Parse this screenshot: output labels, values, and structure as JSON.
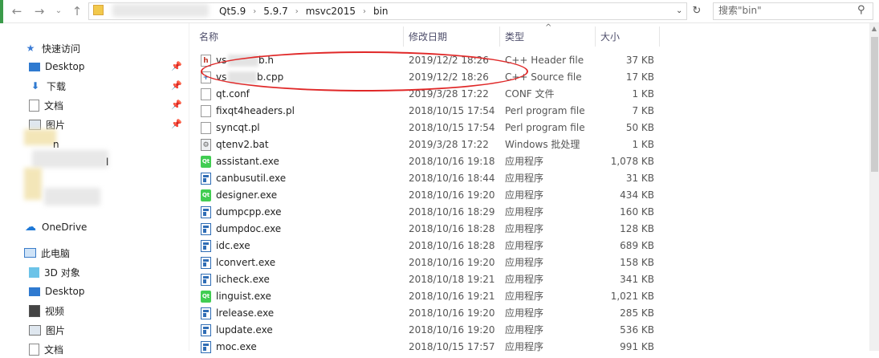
{
  "address": {
    "crumbs": [
      "Qt5.9",
      "5.9.7",
      "msvc2015",
      "bin"
    ],
    "search_placeholder": "搜索\"bin\""
  },
  "sidebar": {
    "items": [
      {
        "label": "快速访问",
        "icon": "star-icon"
      },
      {
        "label": "Desktop",
        "icon": "desktop-icon",
        "pinned": true
      },
      {
        "label": "下载",
        "icon": "download-icon",
        "pinned": true
      },
      {
        "label": "文档",
        "icon": "documents-icon",
        "pinned": true
      },
      {
        "label": "图片",
        "icon": "pictures-icon",
        "pinned": true
      },
      {
        "label": "n",
        "icon": "folder-icon"
      },
      {
        "label": "l",
        "icon": "folder-icon"
      },
      {
        "label": "OneDrive",
        "icon": "onedrive-icon"
      },
      {
        "label": "此电脑",
        "icon": "this-pc-icon"
      },
      {
        "label": "3D 对象",
        "icon": "3d-objects-icon"
      },
      {
        "label": "Desktop",
        "icon": "desktop-icon"
      },
      {
        "label": "视频",
        "icon": "videos-icon"
      },
      {
        "label": "图片",
        "icon": "pictures-icon"
      },
      {
        "label": "文档",
        "icon": "documents-icon"
      }
    ]
  },
  "columns": {
    "name": "名称",
    "date": "修改日期",
    "type": "类型",
    "size": "大小"
  },
  "files": [
    {
      "name_start": "vs",
      "name_end": "b.h",
      "date": "2019/12/2 18:26",
      "type": "C++ Header file",
      "size": "37 KB",
      "icon": "header-file-icon"
    },
    {
      "name_start": "vs",
      "name_end": "b.cpp",
      "date": "2019/12/2 18:26",
      "type": "C++ Source file",
      "size": "17 KB",
      "icon": "cpp-file-icon"
    },
    {
      "name": "qt.conf",
      "date": "2019/3/28 17:22",
      "type": "CONF 文件",
      "size": "1 KB",
      "icon": "file-icon"
    },
    {
      "name": "fixqt4headers.pl",
      "date": "2018/10/15 17:54",
      "type": "Perl program file",
      "size": "7 KB",
      "icon": "file-icon"
    },
    {
      "name": "syncqt.pl",
      "date": "2018/10/15 17:54",
      "type": "Perl program file",
      "size": "50 KB",
      "icon": "file-icon"
    },
    {
      "name": "qtenv2.bat",
      "date": "2019/3/28 17:22",
      "type": "Windows 批处理",
      "size": "1 KB",
      "icon": "batch-file-icon"
    },
    {
      "name": "assistant.exe",
      "date": "2018/10/16 19:18",
      "type": "应用程序",
      "size": "1,078 KB",
      "icon": "qt-app-icon"
    },
    {
      "name": "canbusutil.exe",
      "date": "2018/10/16 18:44",
      "type": "应用程序",
      "size": "31 KB",
      "icon": "exe-icon"
    },
    {
      "name": "designer.exe",
      "date": "2018/10/16 19:20",
      "type": "应用程序",
      "size": "434 KB",
      "icon": "qt-app-icon"
    },
    {
      "name": "dumpcpp.exe",
      "date": "2018/10/16 18:29",
      "type": "应用程序",
      "size": "160 KB",
      "icon": "exe-icon"
    },
    {
      "name": "dumpdoc.exe",
      "date": "2018/10/16 18:28",
      "type": "应用程序",
      "size": "128 KB",
      "icon": "exe-icon"
    },
    {
      "name": "idc.exe",
      "date": "2018/10/16 18:28",
      "type": "应用程序",
      "size": "689 KB",
      "icon": "exe-icon"
    },
    {
      "name": "lconvert.exe",
      "date": "2018/10/16 19:20",
      "type": "应用程序",
      "size": "158 KB",
      "icon": "exe-icon"
    },
    {
      "name": "licheck.exe",
      "date": "2018/10/18 19:21",
      "type": "应用程序",
      "size": "341 KB",
      "icon": "exe-icon"
    },
    {
      "name": "linguist.exe",
      "date": "2018/10/16 19:21",
      "type": "应用程序",
      "size": "1,021 KB",
      "icon": "qt-app-icon"
    },
    {
      "name": "lrelease.exe",
      "date": "2018/10/16 19:20",
      "type": "应用程序",
      "size": "285 KB",
      "icon": "exe-icon"
    },
    {
      "name": "lupdate.exe",
      "date": "2018/10/16 19:20",
      "type": "应用程序",
      "size": "536 KB",
      "icon": "exe-icon"
    },
    {
      "name": "moc.exe",
      "date": "2018/10/15 17:57",
      "type": "应用程序",
      "size": "991 KB",
      "icon": "exe-icon"
    }
  ],
  "colors": {
    "annotation": "#e02828",
    "qt_green": "#41cd52",
    "exe_blue": "#2f6db5"
  }
}
